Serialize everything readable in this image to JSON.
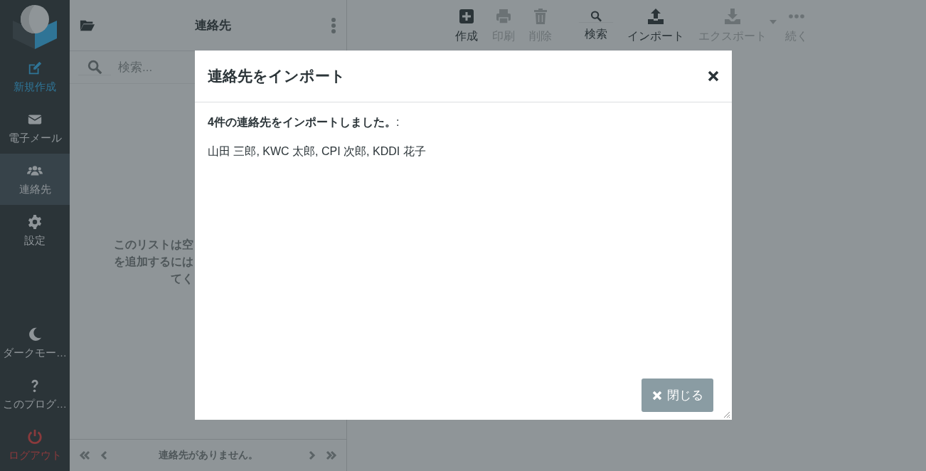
{
  "sidebar": {
    "items": [
      {
        "kind": "compose",
        "label": "新規作成",
        "selected": false
      },
      {
        "kind": "mail",
        "label": "電子メール",
        "selected": false
      },
      {
        "kind": "contacts",
        "label": "連絡先",
        "selected": true
      },
      {
        "kind": "settings",
        "label": "設定",
        "selected": false
      }
    ],
    "bottom_items": [
      {
        "kind": "moon",
        "label": "ダークモー…"
      },
      {
        "kind": "help",
        "label": "このプログ…"
      },
      {
        "kind": "logout",
        "label": "ログアウト"
      }
    ]
  },
  "list_panel": {
    "title": "連絡先",
    "search": {
      "placeholder": "検索..."
    },
    "empty_message": [
      "このリストは空",
      "を追加するには",
      "てく"
    ],
    "footer": {
      "status": "連絡先がありません。"
    }
  },
  "toolbar": [
    {
      "kind": "create",
      "label": "作成",
      "disabled": false
    },
    {
      "kind": "print",
      "label": "印刷",
      "disabled": true
    },
    {
      "kind": "delete",
      "label": "削除",
      "disabled": true
    },
    {
      "kind": "search",
      "label": "検索",
      "disabled": false
    },
    {
      "kind": "import",
      "label": "インポート",
      "disabled": false
    },
    {
      "kind": "export",
      "label": "エクスポート",
      "disabled": true
    },
    {
      "kind": "more",
      "label": "続く",
      "disabled": true
    }
  ],
  "dialog": {
    "title": "連絡先をインポート",
    "message": "**4件の連絡先をインポートしました。**:",
    "names": "山田 三郎, KWC 太郎, CPI 次郎, KDDI 花子",
    "close_button": "閉じる"
  }
}
